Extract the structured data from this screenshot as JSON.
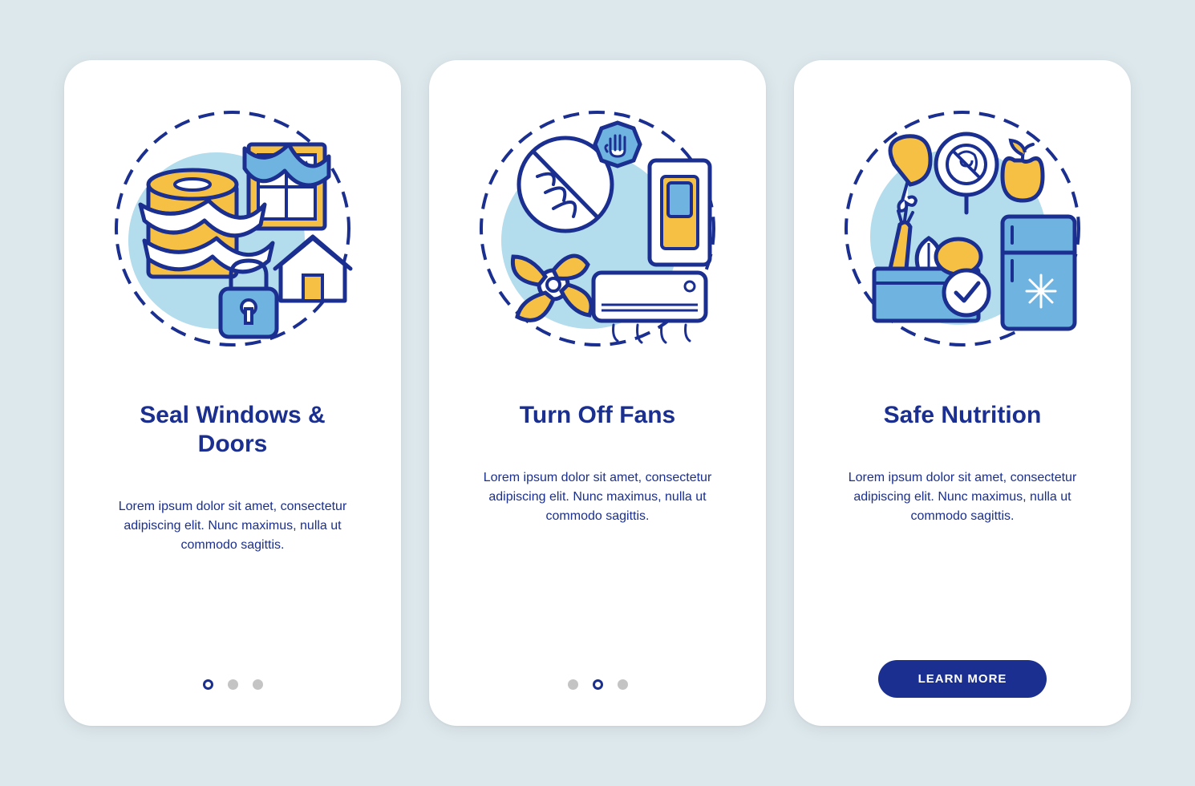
{
  "cards": [
    {
      "title": "Seal Windows & Doors",
      "description": "Lorem ipsum dolor sit amet, consectetur adipiscing elit. Nunc maximus, nulla ut commodo sagittis.",
      "activeIndex": 0,
      "hasButton": false,
      "iconName": "seal-windows-icon"
    },
    {
      "title": "Turn Off Fans",
      "description": "Lorem ipsum dolor sit amet, consectetur adipiscing elit. Nunc maximus, nulla ut commodo sagittis.",
      "activeIndex": 1,
      "hasButton": false,
      "iconName": "turn-off-fans-icon"
    },
    {
      "title": "Safe Nutrition",
      "description": "Lorem ipsum dolor sit amet, consectetur adipiscing elit. Nunc maximus, nulla ut commodo sagittis.",
      "activeIndex": 2,
      "hasButton": true,
      "iconName": "safe-nutrition-icon"
    }
  ],
  "buttonLabel": "LEARN MORE",
  "colors": {
    "primary": "#1a2f8f",
    "accent": "#f5c044",
    "light": "#6fb3e0",
    "lighter": "#b3dced",
    "bg": "#dde8ed"
  }
}
